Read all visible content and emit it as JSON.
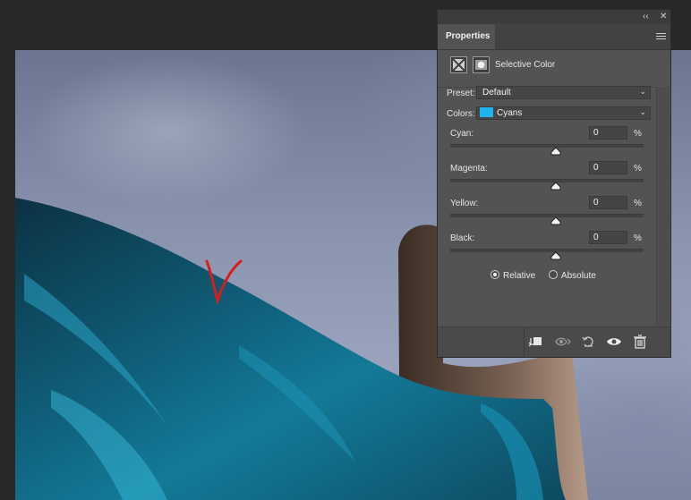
{
  "panel": {
    "tab_label": "Properties",
    "adjustment_title": "Selective Color",
    "preset": {
      "label": "Preset:",
      "value": "Default"
    },
    "colors": {
      "label": "Colors:",
      "value": "Cyans",
      "swatch_color": "#1fb4ef"
    },
    "sliders": [
      {
        "label": "Cyan:",
        "value": "0",
        "unit": "%"
      },
      {
        "label": "Magenta:",
        "value": "0",
        "unit": "%"
      },
      {
        "label": "Yellow:",
        "value": "0",
        "unit": "%"
      },
      {
        "label": "Black:",
        "value": "0",
        "unit": "%"
      }
    ],
    "method": {
      "options": [
        "Relative",
        "Absolute"
      ],
      "selected": "Relative"
    },
    "topbar": {
      "collapse": "‹‹",
      "close": "✕"
    }
  },
  "colors": {
    "panel_bg": "#535353",
    "field_bg": "#454545",
    "swatch_cyan": "#1fb4ef",
    "fabric": "#0e5f78",
    "annotation": "#d81c1c"
  }
}
